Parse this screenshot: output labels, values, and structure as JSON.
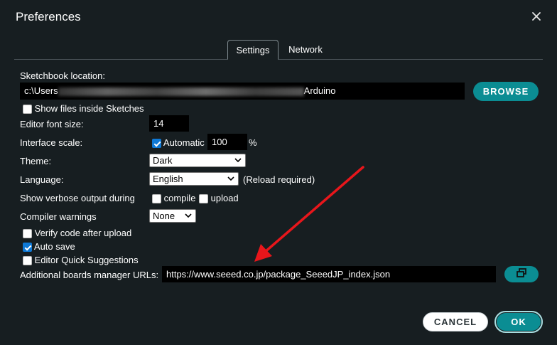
{
  "dialog": {
    "title": "Preferences"
  },
  "tabs": [
    {
      "label": "Settings",
      "active": true
    },
    {
      "label": "Network",
      "active": false
    }
  ],
  "sketchbook": {
    "label": "Sketchbook location:",
    "path_prefix": "c:\\Users",
    "path_suffix": "Arduino",
    "browse_label": "BROWSE"
  },
  "show_files": {
    "label": "Show files inside Sketches",
    "checked": false
  },
  "font_size": {
    "label": "Editor font size:",
    "value": "14"
  },
  "interface_scale": {
    "label": "Interface scale:",
    "automatic_label": "Automatic",
    "automatic_checked": true,
    "value": "100",
    "unit": "%"
  },
  "theme": {
    "label": "Theme:",
    "value": "Dark"
  },
  "language": {
    "label": "Language:",
    "value": "English",
    "note": "(Reload required)"
  },
  "verbose": {
    "label": "Show verbose output during",
    "compile_label": "compile",
    "compile_checked": false,
    "upload_label": "upload",
    "upload_checked": false
  },
  "compiler_warnings": {
    "label": "Compiler warnings",
    "value": "None"
  },
  "verify": {
    "label": "Verify code after upload",
    "checked": false
  },
  "auto_save": {
    "label": "Auto save",
    "checked": true
  },
  "quick_suggestions": {
    "label": "Editor Quick Suggestions",
    "checked": false
  },
  "boards_urls": {
    "label": "Additional boards manager URLs:",
    "value": "https://www.seeed.co.jp/package_SeeedJP_index.json"
  },
  "footer": {
    "cancel_label": "CANCEL",
    "ok_label": "OK"
  },
  "colors": {
    "background": "#171e21",
    "accent": "#0b8d93",
    "annotation_arrow": "#e8161b"
  },
  "icons": {
    "close": "close-icon",
    "url_editor": "open-window-icon",
    "dropdown": "chevron-down-icon"
  }
}
